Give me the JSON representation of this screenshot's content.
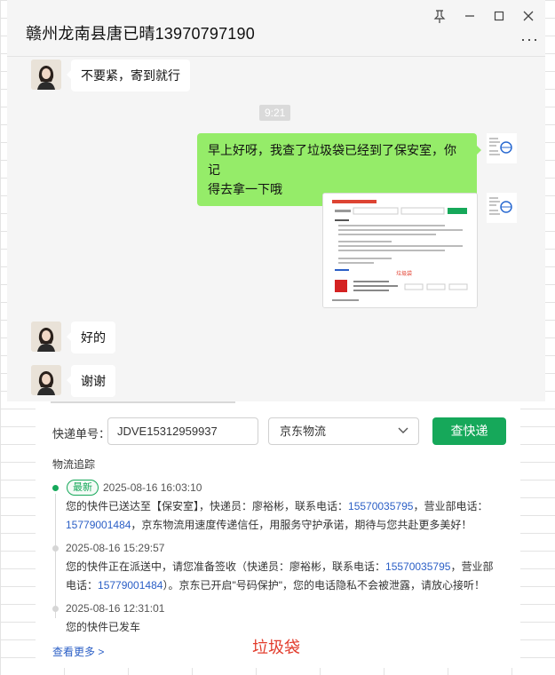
{
  "window": {
    "title": "赣州龙南县唐已晴13970797190",
    "pin_icon": "pin-icon",
    "minimize_icon": "minimize-icon",
    "maximize_icon": "maximize-icon",
    "close_icon": "close-icon",
    "more_label": "···"
  },
  "messages": [
    {
      "from": "other",
      "text": "不要紧，寄到就行"
    },
    {
      "type": "time",
      "text": "9:21"
    },
    {
      "from": "self",
      "text_line1": "早上好呀，我查了垃圾袋已经到了保安室，你记",
      "text_line2": "得去拿一下哦"
    },
    {
      "from": "self",
      "type": "image",
      "caption": "垃圾袋"
    },
    {
      "from": "other",
      "text": "好的"
    },
    {
      "from": "other",
      "text": "谢谢"
    }
  ],
  "tracking": {
    "number_label": "快递单号：",
    "number_value": "JDVE15312959937",
    "carrier": "京东物流",
    "query_button": "查快递",
    "section_title": "物流追踪",
    "latest_badge": "最新",
    "events": [
      {
        "time": "2025-08-16 16:03:10",
        "line1_a": "您的快件已送达至【保安室】，快递员：廖裕彬，联系电话：",
        "line1_phone": "15570035795",
        "line1_b": "，营业部电话：",
        "line2_phone": "15779001484",
        "line2_b": "，京东物流用速度传递信任，用服务守护承诺，期待与您共赴更多美好！"
      },
      {
        "time": "2025-08-16 15:29:57",
        "line1_a": "您的快件正在派送中，请您准备签收（快递员：廖裕彬，联系电话：",
        "line1_phone": "15570035795",
        "line1_b": "，营业部",
        "line2_a": "电话：",
        "line2_phone": "15779001484",
        "line2_b": "）。京东已开启\"号码保护\"，您的电话隐私不会被泄露，请放心接听！"
      },
      {
        "time": "2025-08-16 12:31:01",
        "line1_a": "您的快件已发车"
      }
    ],
    "more_link": "查看更多 >",
    "watermark": "垃圾袋"
  },
  "colors": {
    "bubble_self": "#95ec69",
    "accent_green": "#16a85a",
    "phone_blue": "#2b5fc6",
    "watermark_red": "#e23c2c"
  }
}
